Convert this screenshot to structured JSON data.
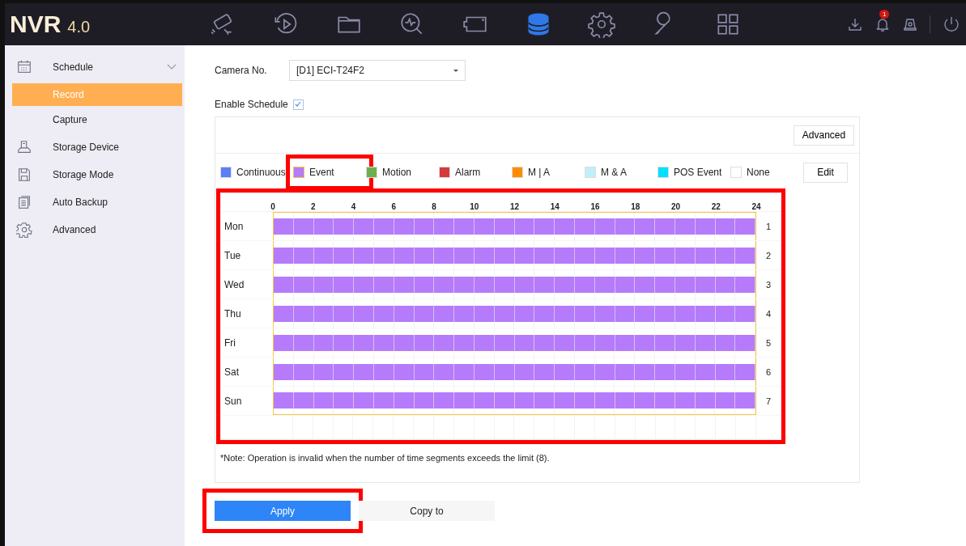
{
  "app": {
    "logo": "NVR",
    "version": "4.0"
  },
  "nav": [
    {
      "selected": false
    },
    {
      "selected": false
    },
    {
      "selected": false
    },
    {
      "selected": false
    },
    {
      "selected": false
    },
    {
      "selected": true
    },
    {
      "selected": false
    },
    {
      "selected": false
    },
    {
      "selected": false
    }
  ],
  "tray": {
    "notification_count": "1"
  },
  "sidebar": {
    "items": [
      {
        "label": "Schedule",
        "expanded": true,
        "children": [
          {
            "label": "Record",
            "selected": true
          },
          {
            "label": "Capture",
            "selected": false
          }
        ]
      },
      {
        "label": "Storage Device"
      },
      {
        "label": "Storage Mode"
      },
      {
        "label": "Auto Backup"
      },
      {
        "label": "Advanced"
      }
    ]
  },
  "camera": {
    "label": "Camera No.",
    "value": "[D1] ECI-T24F2"
  },
  "enable_schedule": {
    "label": "Enable Schedule",
    "checked": true
  },
  "advanced_button": "Advanced",
  "legend": [
    {
      "label": "Continuous",
      "color": "#5b7ff5",
      "selected": false,
      "highlighted": false
    },
    {
      "label": "Event",
      "color": "#b57bfb",
      "selected": true,
      "highlighted": true
    },
    {
      "label": "Motion",
      "color": "#6ab04c",
      "selected": false,
      "highlighted": false
    },
    {
      "label": "Alarm",
      "color": "#d63b3b",
      "selected": false,
      "highlighted": false
    },
    {
      "label": "M | A",
      "color": "#ff8c00",
      "selected": false,
      "highlighted": false
    },
    {
      "label": "M & A",
      "color": "#c0effa",
      "selected": false,
      "highlighted": false
    },
    {
      "label": "POS Event",
      "color": "#00e0ff",
      "selected": false,
      "highlighted": false
    },
    {
      "label": "None",
      "color": "#ffffff",
      "selected": false,
      "highlighted": false
    }
  ],
  "edit_button": "Edit",
  "schedule": {
    "highlighted": true,
    "hours": [
      "0",
      "2",
      "4",
      "6",
      "8",
      "10",
      "12",
      "14",
      "16",
      "18",
      "20",
      "22",
      "24"
    ],
    "days": [
      {
        "label": "Mon",
        "number": "1",
        "level": 1,
        "color": "#b57bfb"
      },
      {
        "label": "Tue",
        "number": "2",
        "level": 1,
        "color": "#b57bfb"
      },
      {
        "label": "Wed",
        "number": "3",
        "level": 1,
        "color": "#b57bfb"
      },
      {
        "label": "Thu",
        "number": "4",
        "level": 1,
        "color": "#b57bfb"
      },
      {
        "label": "Fri",
        "number": "5",
        "level": 1,
        "color": "#b57bfb"
      },
      {
        "label": "Sat",
        "number": "6",
        "level": 1,
        "color": "#b57bfb"
      },
      {
        "label": "Sun",
        "number": "7",
        "level": 1,
        "color": "#b57bfb"
      }
    ]
  },
  "note": "*Note: Operation is invalid when the number of time segments exceeds the limit (8).",
  "buttons": [
    {
      "label": "Apply",
      "kind": "primary",
      "highlighted": true
    },
    {
      "label": "Copy to",
      "kind": "secondary",
      "highlighted": false
    }
  ]
}
